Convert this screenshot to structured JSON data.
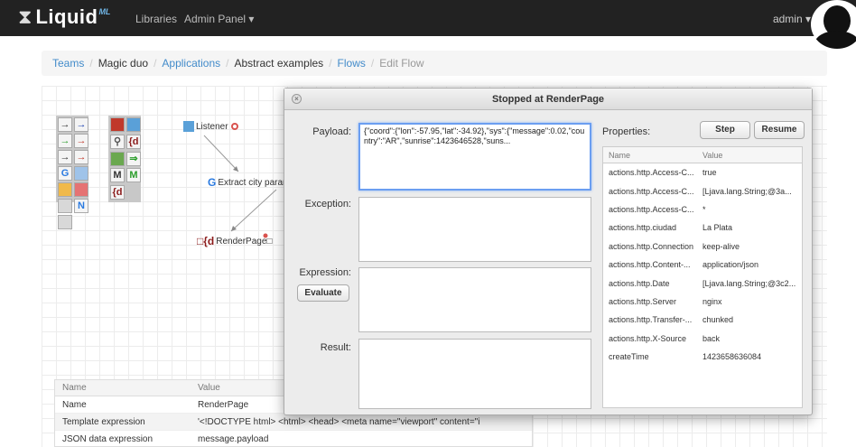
{
  "nav": {
    "brand": "Liquid",
    "brand_sup": "ML",
    "libraries": "Libraries",
    "admin_panel": "Admin Panel",
    "user": "admin"
  },
  "breadcrumb": {
    "teams": "Teams",
    "team": "Magic duo",
    "applications": "Applications",
    "application": "Abstract examples",
    "flows": "Flows",
    "current": "Edit Flow",
    "separator": "/"
  },
  "palette": {
    "tools": [
      "→",
      "→",
      "",
      "",
      "→",
      "→",
      "",
      "{d",
      "→",
      "→",
      "",
      "",
      "G",
      "",
      "M",
      "M",
      "",
      "",
      "{d",
      "",
      "",
      "N",
      "",
      "",
      "",
      "",
      "",
      ""
    ]
  },
  "nodes": {
    "listener": "Listener",
    "extract": "Extract city param",
    "render": "RenderPage"
  },
  "props": {
    "headers": {
      "name": "Name",
      "value": "Value"
    },
    "rows": [
      {
        "name": "Name",
        "value": "RenderPage"
      },
      {
        "name": "Template expression",
        "value": "'<!DOCTYPE html> <html>  <head>   <meta name=\"viewport\" content=\"i"
      },
      {
        "name": "JSON data expression",
        "value": "message.payload"
      }
    ]
  },
  "dialog": {
    "title": "Stopped at RenderPage",
    "payload_label": "Payload:",
    "payload_value": "{\"coord\":{\"lon\":-57.95,\"lat\":-34.92},\"sys\":{\"message\":0.02,\"country\":\"AR\",\"sunrise\":1423646528,\"suns...",
    "exception_label": "Exception:",
    "expression_label": "Expression:",
    "evaluate": "Evaluate",
    "result_label": "Result:",
    "properties_label": "Properties:",
    "step": "Step",
    "resume": "Resume",
    "table_headers": {
      "name": "Name",
      "value": "Value"
    },
    "properties": [
      {
        "k": "actions.http.Access-C...",
        "v": "true"
      },
      {
        "k": "actions.http.Access-C...",
        "v": "[Ljava.lang.String;@3a..."
      },
      {
        "k": "actions.http.Access-C...",
        "v": "*"
      },
      {
        "k": "actions.http.ciudad",
        "v": "La Plata"
      },
      {
        "k": "actions.http.Connection",
        "v": "keep-alive"
      },
      {
        "k": "actions.http.Content-...",
        "v": "application/json"
      },
      {
        "k": "actions.http.Date",
        "v": "[Ljava.lang.String;@3c2..."
      },
      {
        "k": "actions.http.Server",
        "v": "nginx"
      },
      {
        "k": "actions.http.Transfer-...",
        "v": "chunked"
      },
      {
        "k": "actions.http.X-Source",
        "v": "back"
      },
      {
        "k": "createTime",
        "v": "1423658636084"
      }
    ]
  },
  "colors": {
    "navbar": "#222222",
    "link": "#428bca",
    "focus": "#6b9ef1",
    "red": "#d9534f"
  }
}
